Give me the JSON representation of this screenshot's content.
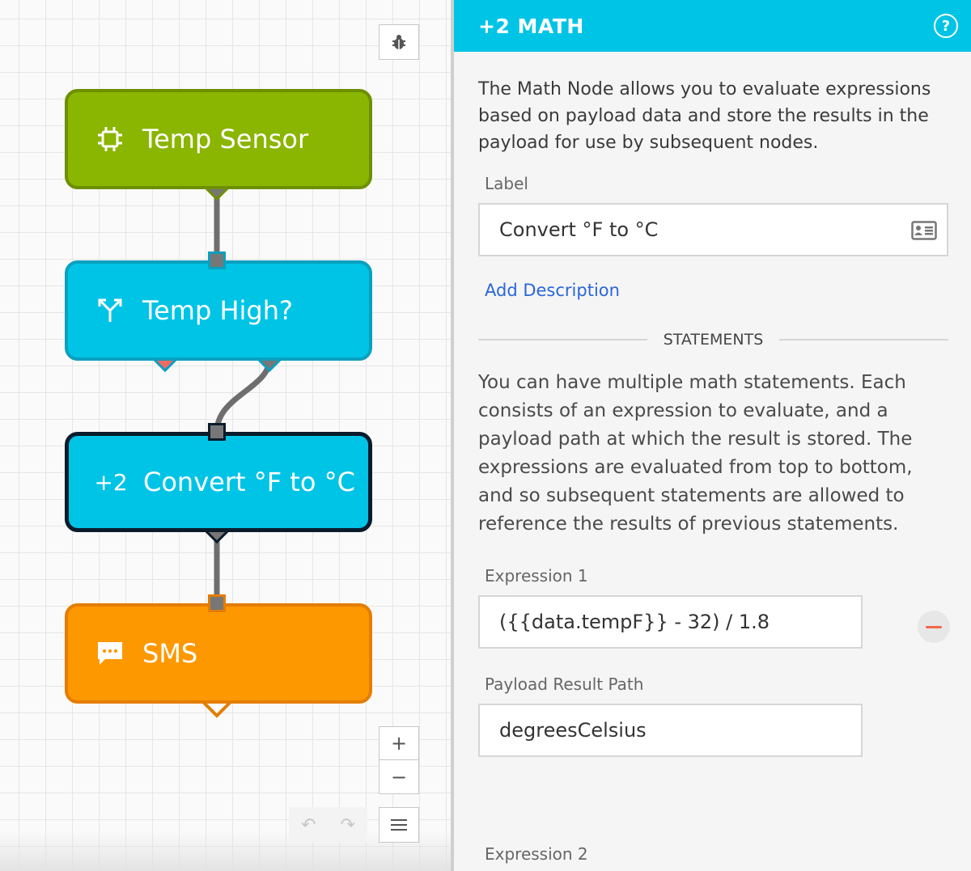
{
  "canvas": {
    "toolbar": {
      "debug_icon": "bug-icon",
      "zoom_in": "+",
      "zoom_out": "−",
      "menu_icon": "menu-icon",
      "undo_icon": "undo-icon",
      "redo_icon": "redo-icon"
    },
    "nodes": [
      {
        "id": "temp-sensor",
        "label": "Temp Sensor",
        "icon": "chip-icon",
        "color": "#8ab500"
      },
      {
        "id": "temp-high",
        "label": "Temp High?",
        "icon": "branch-icon",
        "color": "#00c4e6"
      },
      {
        "id": "convert",
        "label": "Convert °F to °C",
        "icon_text": "+2",
        "color": "#00c4e6"
      },
      {
        "id": "sms",
        "label": "SMS",
        "icon": "chat-icon",
        "color": "#fd9800"
      }
    ]
  },
  "panel": {
    "title": "+2 MATH",
    "accent": "#00c4e6",
    "intro": "The Math Node allows you to evaluate expressions based on payload data and store the results in the payload for use by subsequent nodes.",
    "label_caption": "Label",
    "label_value": "Convert °F to °C",
    "add_description": "Add Description",
    "section_title": "STATEMENTS",
    "statements_desc": "You can have multiple math statements. Each consists of an expression to evaluate, and a payload path at which the result is stored. The expressions are evaluated from top to bottom, and so subsequent statements are allowed to reference the results of previous statements.",
    "expression1_caption": "Expression 1",
    "expression1_value": "({{data.tempF}} - 32) / 1.8",
    "result_path_caption": "Payload Result Path",
    "result_path_value": "degreesCelsius",
    "expression2_caption": "Expression 2"
  }
}
